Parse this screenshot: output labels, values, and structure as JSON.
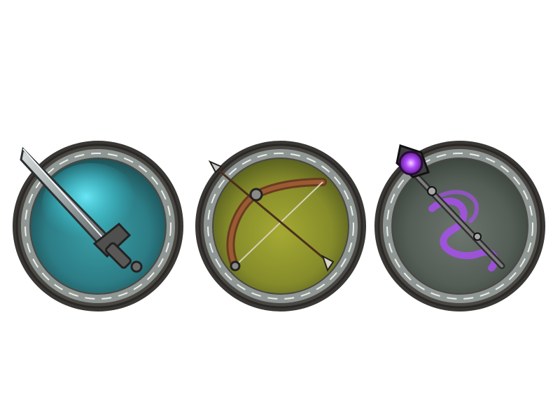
{
  "icons": [
    {
      "name": "sword",
      "icon": "sword-icon",
      "glow_color": "#3fc6d6",
      "inner_color": "#2f8f98"
    },
    {
      "name": "bow",
      "icon": "bow-icon",
      "glow_color": "#9aa23a",
      "inner_color": "#7f8a26"
    },
    {
      "name": "staff",
      "icon": "magic-staff-icon",
      "glow_color": "#a24ce6",
      "inner_color": "#5e6a5e"
    }
  ],
  "colors": {
    "stone_outer": "#3b3936",
    "stone_ring": "#8f9794",
    "stone_dark": "#2a2826"
  }
}
